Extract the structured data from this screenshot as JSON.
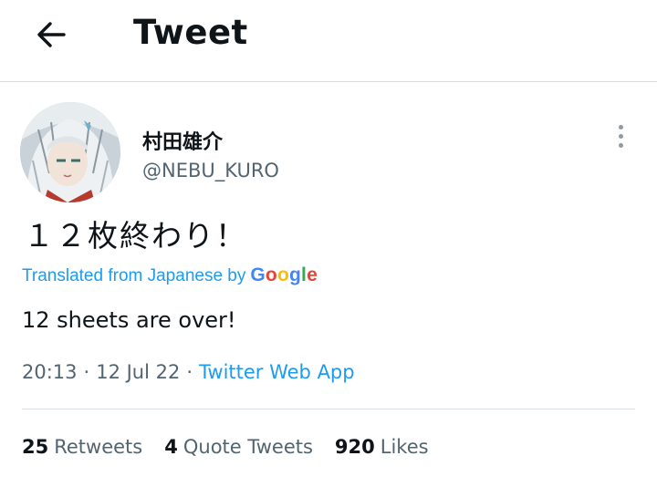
{
  "header": {
    "title": "Tweet",
    "back_icon": "arrow-left-icon"
  },
  "author": {
    "display_name": "村田雄介",
    "handle": "@NEBU_KURO",
    "avatar_icon": "anime-character-avatar"
  },
  "tweet": {
    "text": "１２枚終わり！",
    "translated_label": "Translated from Japanese by",
    "translator_logo_letters": [
      "G",
      "o",
      "o",
      "g",
      "l",
      "e"
    ],
    "translator_logo_colors": [
      "#4285F4",
      "#EA4335",
      "#FBBC05",
      "#4285F4",
      "#34A853",
      "#EA4335"
    ],
    "translation": "12 sheets are over!",
    "time": "20:13",
    "separator": "·",
    "date": "12 Jul 22",
    "source": "Twitter Web App"
  },
  "stats": {
    "retweets_count": "25",
    "retweets_label": "Retweets",
    "quotes_count": "4",
    "quotes_label": "Quote Tweets",
    "likes_count": "920",
    "likes_label": "Likes"
  },
  "colors": {
    "accent": "#1d9bf0",
    "text_primary": "#0f1419",
    "text_secondary": "#536471",
    "divider": "#d8dde1"
  }
}
